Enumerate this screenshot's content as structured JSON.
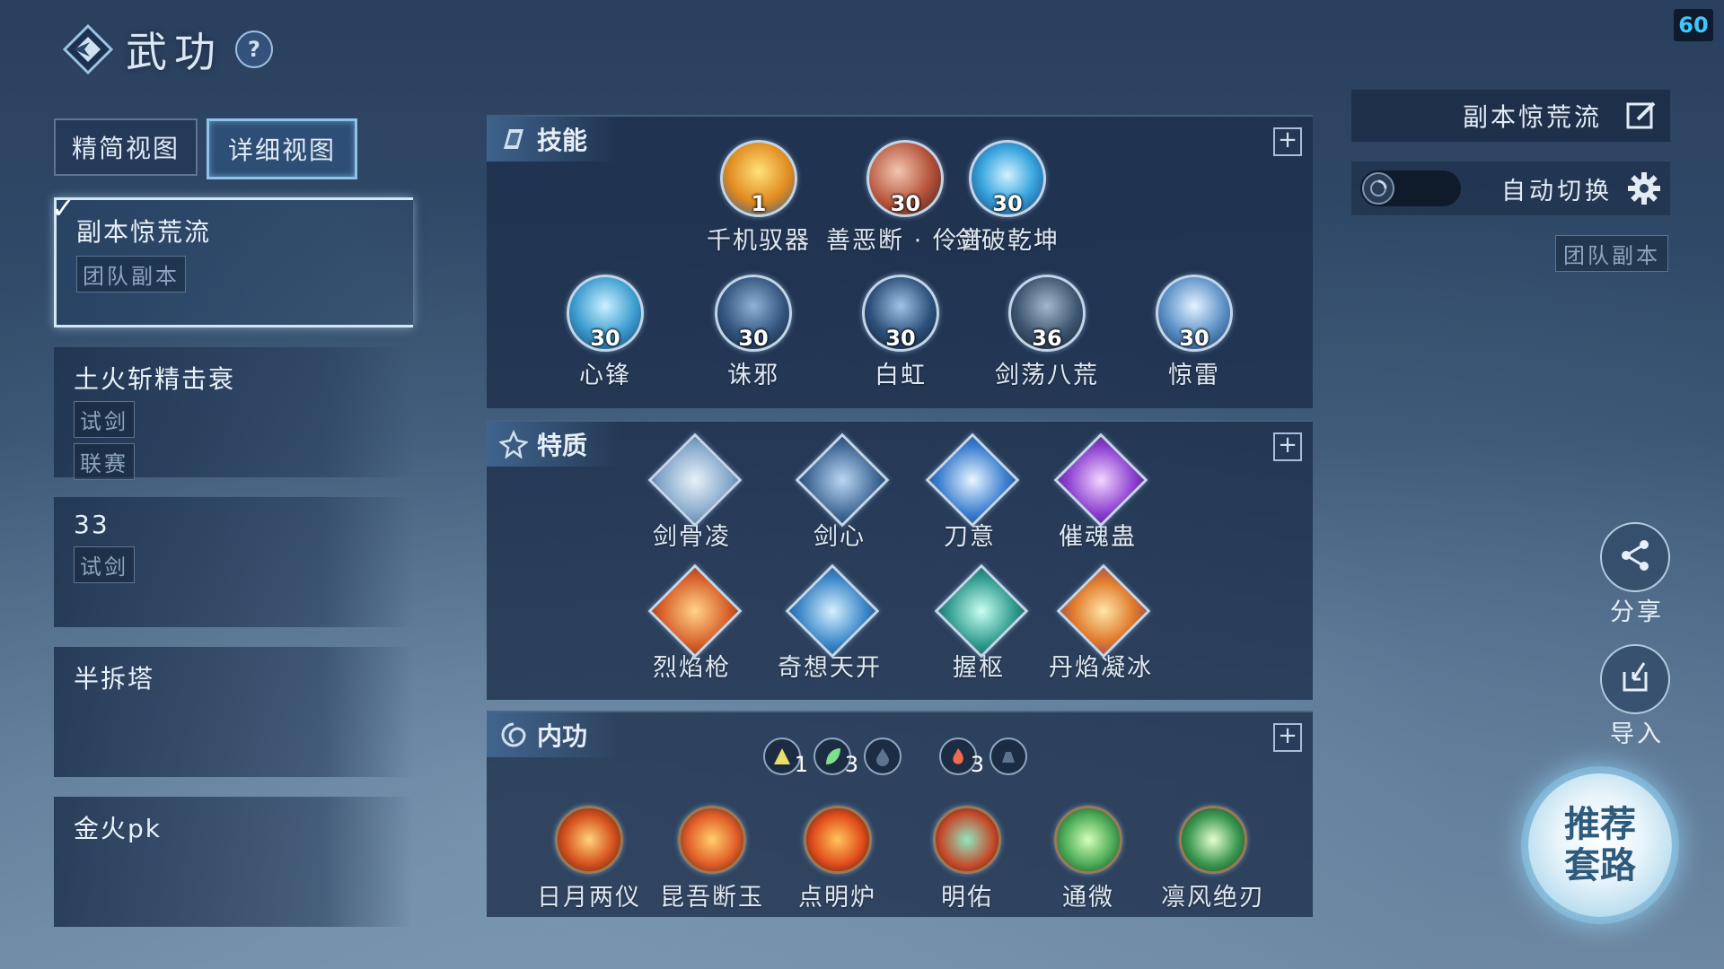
{
  "fps": "60",
  "header": {
    "title": "武功",
    "help": "?"
  },
  "view_toggle": {
    "simple": "精简视图",
    "detailed": "详细视图"
  },
  "presets": [
    {
      "name": "副本惊荒流",
      "tags": [
        "团队副本"
      ],
      "selected": true
    },
    {
      "name": "土火斩精击衰",
      "tags": [
        "试剑",
        "联赛"
      ]
    },
    {
      "name": "33",
      "tags": [
        "试剑"
      ]
    },
    {
      "name": "半拆塔",
      "tags": []
    },
    {
      "name": "金火pk",
      "tags": []
    }
  ],
  "skills_panel": {
    "title": "技能",
    "skills": [
      {
        "name": "千机驭器",
        "level": "1"
      },
      {
        "name": "善恶断 · 伶音",
        "level": "30"
      },
      {
        "name": "剑破乾坤",
        "level": "30"
      },
      {
        "name": "心锋",
        "level": "30"
      },
      {
        "name": "诛邪",
        "level": "30"
      },
      {
        "name": "白虹",
        "level": "30"
      },
      {
        "name": "剑荡八荒",
        "level": "36"
      },
      {
        "name": "惊雷",
        "level": "30"
      }
    ]
  },
  "traits_panel": {
    "title": "特质",
    "traits": [
      "剑骨凌",
      "剑心",
      "刀意",
      "催魂蛊",
      "烈焰枪",
      "奇想天开",
      "握枢",
      "丹焰凝冰"
    ]
  },
  "neigong_panel": {
    "title": "内功",
    "elements": [
      {
        "icon": "mountain-element-icon",
        "count": "1"
      },
      {
        "icon": "leaf-element-icon",
        "count": "3"
      },
      {
        "icon": "water-element-icon",
        "count": ""
      },
      {
        "icon": "fire-element-icon",
        "count": "3"
      },
      {
        "icon": "earth-element-icon",
        "count": ""
      }
    ],
    "items": [
      "日月两仪",
      "昆吾断玉",
      "点明炉",
      "明佑",
      "通微",
      "凛风绝刃"
    ]
  },
  "sidebar": {
    "preset_title": "副本惊荒流",
    "auto_switch": "自动切换",
    "tag": "团队副本",
    "share": "分享",
    "import": "导入",
    "recommend": "推荐套路"
  },
  "colors": {
    "accent": "#8ec2ea",
    "fps": "#3fc6ff"
  }
}
